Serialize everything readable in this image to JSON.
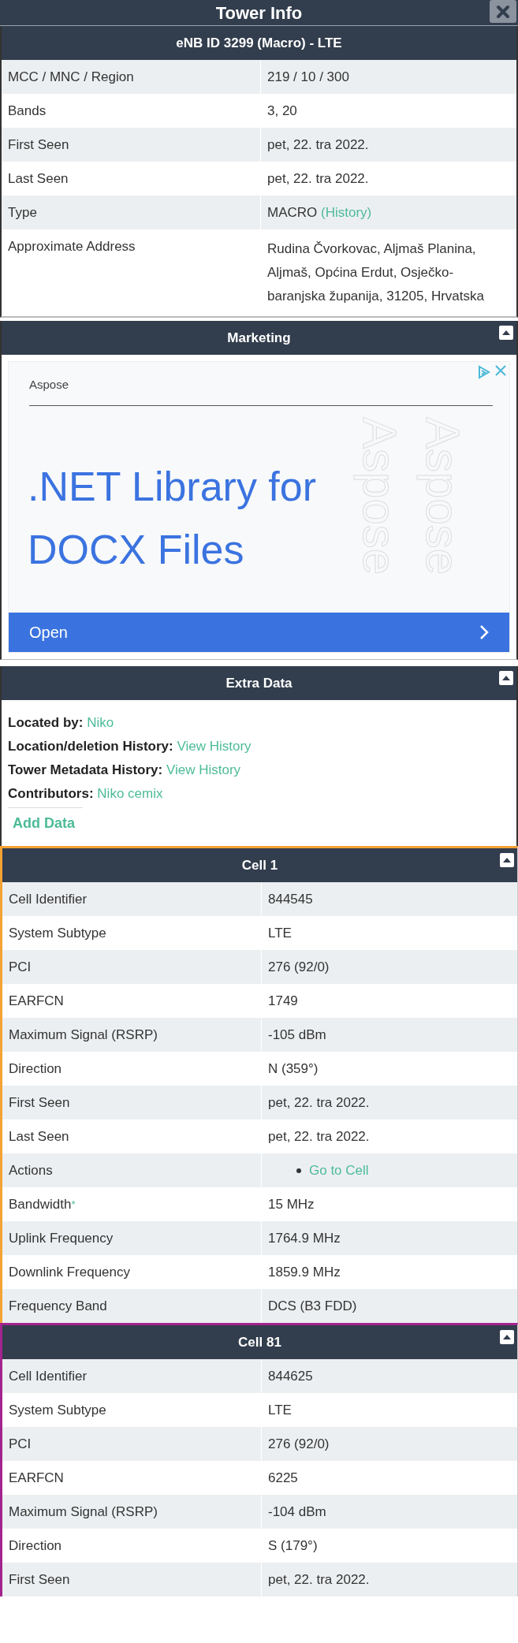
{
  "window": {
    "title": "Tower Info"
  },
  "tower": {
    "title": "eNB ID 3299 (Macro) - LTE",
    "rows": [
      {
        "kind": "text",
        "label": "MCC / MNC / Region",
        "value": "219 / 10 / 300"
      },
      {
        "kind": "text",
        "label": "Bands",
        "value": "3, 20"
      },
      {
        "kind": "text",
        "label": "First Seen",
        "value": "pet, 22. tra 2022."
      },
      {
        "kind": "text",
        "label": "Last Seen",
        "value": "pet, 22. tra 2022."
      },
      {
        "kind": "link",
        "label": "Type",
        "value": "MACRO",
        "link": "(History)"
      },
      {
        "kind": "text",
        "label": "Approximate Address",
        "value": "Rudina Čvorkovac, Aljmaš Planina, Aljmaš, Općina Erdut, Osječko-baranjska županija, 31205, Hrvatska"
      }
    ]
  },
  "marketing": {
    "title": "Marketing",
    "ad": {
      "advertiser": "Aspose",
      "headline": ".NET Library for DOCX Files",
      "background_text": [
        "Aspose",
        "Aspose"
      ],
      "button": "Open"
    }
  },
  "extra_data": {
    "title": "Extra Data",
    "items": [
      {
        "label": "Located by:",
        "link": "Niko"
      },
      {
        "label": "Location/deletion History:",
        "link": "View History"
      },
      {
        "label": "Tower Metadata History:",
        "link": "View History"
      },
      {
        "label": "Contributors:",
        "link": "Niko cemix"
      }
    ],
    "add_button": "Add Data"
  },
  "cells": [
    {
      "title": "Cell 1",
      "color": "#f3a233",
      "rows": [
        {
          "kind": "text",
          "label": "Cell Identifier",
          "value": "844545"
        },
        {
          "kind": "text",
          "label": "System Subtype",
          "value": "LTE"
        },
        {
          "kind": "text",
          "label": "PCI",
          "value": "276 (92/0)"
        },
        {
          "kind": "text",
          "label": "EARFCN",
          "value": "1749"
        },
        {
          "kind": "text",
          "label": "Maximum Signal (RSRP)",
          "value": "-105 dBm"
        },
        {
          "kind": "text",
          "label": "Direction",
          "value": "N (359°)"
        },
        {
          "kind": "text",
          "label": "First Seen",
          "value": "pet, 22. tra 2022."
        },
        {
          "kind": "text",
          "label": "Last Seen",
          "value": "pet, 22. tra 2022."
        },
        {
          "kind": "actions",
          "label": "Actions",
          "actions": [
            "Go to Cell"
          ]
        },
        {
          "kind": "text",
          "label": "Bandwidth",
          "footnote": "*",
          "value": "15 MHz"
        },
        {
          "kind": "text",
          "label": "Uplink Frequency",
          "value": "1764.9 MHz"
        },
        {
          "kind": "text",
          "label": "Downlink Frequency",
          "value": "1859.9 MHz"
        },
        {
          "kind": "text",
          "label": "Frequency Band",
          "value": "DCS (B3 FDD)"
        }
      ]
    },
    {
      "title": "Cell 81",
      "color": "#a3238f",
      "rows": [
        {
          "kind": "text",
          "label": "Cell Identifier",
          "value": "844625"
        },
        {
          "kind": "text",
          "label": "System Subtype",
          "value": "LTE"
        },
        {
          "kind": "text",
          "label": "PCI",
          "value": "276 (92/0)"
        },
        {
          "kind": "text",
          "label": "EARFCN",
          "value": "6225"
        },
        {
          "kind": "text",
          "label": "Maximum Signal (RSRP)",
          "value": "-104 dBm"
        },
        {
          "kind": "text",
          "label": "Direction",
          "value": "S (179°)"
        },
        {
          "kind": "text",
          "label": "First Seen",
          "value": "pet, 22. tra 2022."
        }
      ]
    }
  ]
}
